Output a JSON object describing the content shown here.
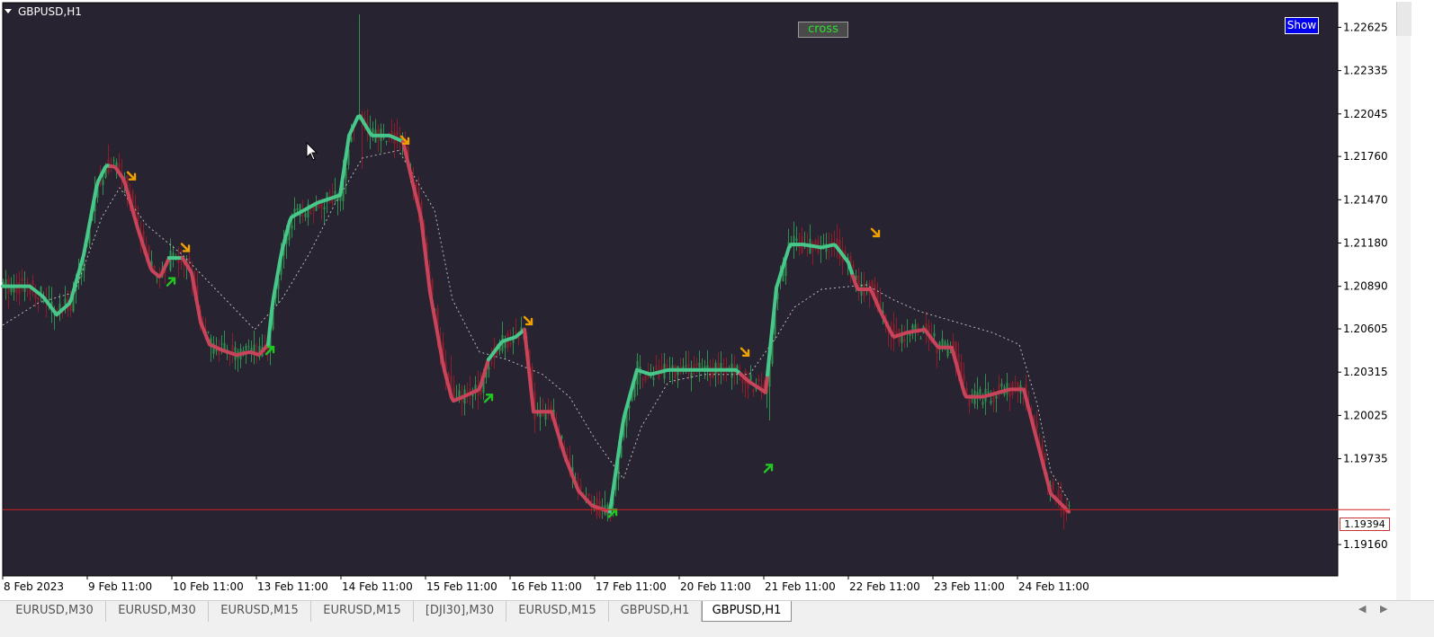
{
  "window": {
    "title": "GBPUSD,H1"
  },
  "indicator_label": "cross",
  "show_button": "Show",
  "current_price": "1.19394",
  "colors": {
    "background": "#272330",
    "bull_candle": "#2f8f4f",
    "bear_candle": "#8b1d2c",
    "trend_up": "#48c78a",
    "trend_down": "#c8445a",
    "signal_down_arrow": "#f0a000",
    "signal_up_arrow": "#22c822",
    "bid_line": "#d22222"
  },
  "chart_data": {
    "type": "candlestick",
    "symbol": "GBPUSD",
    "timeframe": "H1",
    "ylim": [
      1.1895,
      1.2279
    ],
    "price_ticks": [
      "1.22625",
      "1.22335",
      "1.22045",
      "1.21760",
      "1.21470",
      "1.21180",
      "1.20890",
      "1.20605",
      "1.20315",
      "1.20025",
      "1.19735",
      "1.19160"
    ],
    "time_labels": [
      "8 Feb 2023",
      "9 Feb 11:00",
      "10 Feb 11:00",
      "13 Feb 11:00",
      "14 Feb 11:00",
      "15 Feb 11:00",
      "16 Feb 11:00",
      "17 Feb 11:00",
      "20 Feb 11:00",
      "21 Feb 11:00",
      "22 Feb 11:00",
      "23 Feb 11:00",
      "24 Feb 11:00"
    ],
    "last_price": 1.19394,
    "trend_line": [
      [
        0,
        1.2089
      ],
      [
        30,
        1.2089
      ],
      [
        45,
        1.2082
      ],
      [
        60,
        1.207
      ],
      [
        75,
        1.2078
      ],
      [
        90,
        1.211
      ],
      [
        105,
        1.2158
      ],
      [
        115,
        1.217
      ],
      [
        125,
        1.2169
      ],
      [
        135,
        1.216
      ],
      [
        150,
        1.2128
      ],
      [
        165,
        1.21
      ],
      [
        175,
        1.2095
      ],
      [
        185,
        1.2108
      ],
      [
        200,
        1.2108
      ],
      [
        210,
        1.2098
      ],
      [
        220,
        1.2065
      ],
      [
        230,
        1.205
      ],
      [
        245,
        1.2046
      ],
      [
        260,
        1.2043
      ],
      [
        275,
        1.2045
      ],
      [
        285,
        1.2043
      ],
      [
        295,
        1.205
      ],
      [
        300,
        1.2078
      ],
      [
        310,
        1.2112
      ],
      [
        320,
        1.2135
      ],
      [
        335,
        1.214
      ],
      [
        350,
        1.2145
      ],
      [
        375,
        1.215
      ],
      [
        385,
        1.219
      ],
      [
        396,
        1.2204
      ],
      [
        410,
        1.219
      ],
      [
        430,
        1.219
      ],
      [
        445,
        1.2186
      ],
      [
        455,
        1.216
      ],
      [
        465,
        1.2135
      ],
      [
        475,
        1.2085
      ],
      [
        490,
        1.2035
      ],
      [
        500,
        1.2012
      ],
      [
        512,
        1.2015
      ],
      [
        530,
        1.202
      ],
      [
        540,
        1.204
      ],
      [
        555,
        1.2052
      ],
      [
        570,
        1.2055
      ],
      [
        580,
        1.206
      ],
      [
        590,
        1.2005
      ],
      [
        610,
        1.2005
      ],
      [
        625,
        1.1975
      ],
      [
        640,
        1.1952
      ],
      [
        655,
        1.1942
      ],
      [
        675,
        1.1938
      ],
      [
        690,
        1.2
      ],
      [
        705,
        1.2033
      ],
      [
        720,
        1.203
      ],
      [
        740,
        1.2033
      ],
      [
        760,
        1.2033
      ],
      [
        790,
        1.2033
      ],
      [
        815,
        1.2033
      ],
      [
        830,
        1.2025
      ],
      [
        848,
        1.2018
      ],
      [
        860,
        1.2088
      ],
      [
        875,
        1.2117
      ],
      [
        890,
        1.2117
      ],
      [
        910,
        1.2115
      ],
      [
        925,
        1.2117
      ],
      [
        940,
        1.2105
      ],
      [
        950,
        1.2087
      ],
      [
        965,
        1.2087
      ],
      [
        975,
        1.2073
      ],
      [
        990,
        1.2055
      ],
      [
        1005,
        1.2058
      ],
      [
        1025,
        1.206
      ],
      [
        1040,
        1.2048
      ],
      [
        1055,
        1.2048
      ],
      [
        1070,
        1.2015
      ],
      [
        1090,
        1.2015
      ],
      [
        1120,
        1.202
      ],
      [
        1135,
        1.202
      ],
      [
        1150,
        1.1985
      ],
      [
        1165,
        1.195
      ],
      [
        1185,
        1.1938
      ]
    ],
    "trend_segments": [
      {
        "from": 0,
        "to": 120,
        "dir": "up"
      },
      {
        "from": 120,
        "to": 185,
        "dir": "down"
      },
      {
        "from": 185,
        "to": 200,
        "dir": "up"
      },
      {
        "from": 200,
        "to": 295,
        "dir": "down"
      },
      {
        "from": 295,
        "to": 445,
        "dir": "up"
      },
      {
        "from": 445,
        "to": 540,
        "dir": "down"
      },
      {
        "from": 540,
        "to": 580,
        "dir": "up"
      },
      {
        "from": 580,
        "to": 675,
        "dir": "down"
      },
      {
        "from": 675,
        "to": 820,
        "dir": "up"
      },
      {
        "from": 820,
        "to": 850,
        "dir": "down"
      },
      {
        "from": 850,
        "to": 945,
        "dir": "up"
      },
      {
        "from": 945,
        "to": 1185,
        "dir": "down"
      }
    ],
    "dotted_line": [
      [
        0,
        1.2063
      ],
      [
        40,
        1.2078
      ],
      [
        80,
        1.2085
      ],
      [
        110,
        1.2135
      ],
      [
        130,
        1.2155
      ],
      [
        160,
        1.213
      ],
      [
        200,
        1.211
      ],
      [
        240,
        1.2085
      ],
      [
        280,
        1.206
      ],
      [
        310,
        1.208
      ],
      [
        340,
        1.211
      ],
      [
        370,
        1.2145
      ],
      [
        400,
        1.2175
      ],
      [
        440,
        1.218
      ],
      [
        480,
        1.214
      ],
      [
        500,
        1.208
      ],
      [
        530,
        1.2045
      ],
      [
        560,
        1.204
      ],
      [
        600,
        1.203
      ],
      [
        630,
        1.2015
      ],
      [
        660,
        1.1985
      ],
      [
        690,
        1.196
      ],
      [
        710,
        1.1995
      ],
      [
        740,
        1.2025
      ],
      [
        780,
        1.203
      ],
      [
        830,
        1.203
      ],
      [
        860,
        1.2055
      ],
      [
        880,
        1.2075
      ],
      [
        910,
        1.2087
      ],
      [
        960,
        1.209
      ],
      [
        990,
        1.208
      ],
      [
        1020,
        1.2072
      ],
      [
        1060,
        1.2065
      ],
      [
        1100,
        1.2058
      ],
      [
        1130,
        1.205
      ],
      [
        1150,
        1.201
      ],
      [
        1165,
        1.1965
      ],
      [
        1185,
        1.1945
      ]
    ],
    "signals": [
      {
        "x": 143,
        "p": 1.2163,
        "dir": "down"
      },
      {
        "x": 203,
        "p": 1.2115,
        "dir": "down"
      },
      {
        "x": 187,
        "p": 1.2092,
        "dir": "up"
      },
      {
        "x": 297,
        "p": 1.2046,
        "dir": "up"
      },
      {
        "x": 447,
        "p": 1.2187,
        "dir": "down"
      },
      {
        "x": 540,
        "p": 1.2014,
        "dir": "up"
      },
      {
        "x": 584,
        "p": 1.2066,
        "dir": "down"
      },
      {
        "x": 678,
        "p": 1.1937,
        "dir": "up"
      },
      {
        "x": 825,
        "p": 1.2045,
        "dir": "down"
      },
      {
        "x": 851,
        "p": 1.1967,
        "dir": "up"
      },
      {
        "x": 970,
        "p": 1.2125,
        "dir": "down"
      }
    ]
  },
  "tabs": [
    {
      "label": "EURUSD,M30",
      "active": false
    },
    {
      "label": "EURUSD,M30",
      "active": false
    },
    {
      "label": "EURUSD,M15",
      "active": false
    },
    {
      "label": "EURUSD,M15",
      "active": false
    },
    {
      "label": "[DJI30],M30",
      "active": false
    },
    {
      "label": "EURUSD,M15",
      "active": false
    },
    {
      "label": "GBPUSD,H1",
      "active": false
    },
    {
      "label": "GBPUSD,H1",
      "active": true
    }
  ],
  "tab_nav": {
    "left": "◀",
    "right": "▶"
  }
}
